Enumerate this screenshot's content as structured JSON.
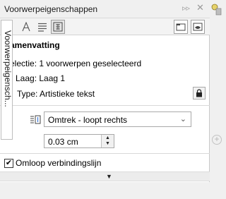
{
  "window": {
    "title": "Voorwerpeigenschappen",
    "controls": [
      "▹▹",
      "✕"
    ]
  },
  "toolbar": {
    "tools": [
      {
        "name": "outline-tool-icon"
      },
      {
        "name": "character-tool-icon"
      },
      {
        "name": "paragraph-tool-icon"
      },
      {
        "name": "frame-tool-icon",
        "selected": true
      }
    ],
    "right_icons": [
      "frame-view-icon",
      "preview-eye-icon"
    ]
  },
  "summary": {
    "header": "Samenvatting",
    "selection_label": "Selectie:",
    "selection_value": "1 voorwerpen geselecteerd",
    "layer_label": "Laag:",
    "layer_value": "Laag 1",
    "type_label": "Type:",
    "type_value": "Artistieke tekst"
  },
  "wrap": {
    "dropdown_value": "Omtrek - loopt rechts",
    "spinner_value": "0.03 cm"
  },
  "checkbox": {
    "checked": true,
    "mark": "✔",
    "label": "Omloop verbindingslijn"
  },
  "side_tab": {
    "label": "Voorwerpeigensch..."
  },
  "colors": {
    "panel_bg": "#ffffff",
    "chrome": "#f0f0f0",
    "border": "#a9a9a9"
  }
}
